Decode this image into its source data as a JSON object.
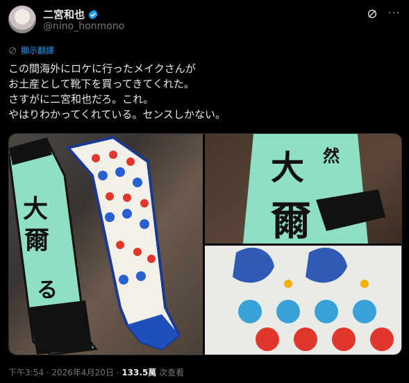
{
  "author": {
    "display_name": "二宮和也",
    "handle": "@nino_honmono"
  },
  "translate_label": "顯示翻譯",
  "tweet_text": "この間海外にロケに行ったメイクさんが\nお土産として靴下を買ってきてくれた。\nさすがに二宮和也だろ。これ。\nやはりわかってくれている。センスしかない。",
  "timestamp": "下午3:54 · 2026年4月20日",
  "views_count": "133.5萬",
  "views_label": "次查看",
  "colors": {
    "background": "#000000",
    "text": "#e7e9ea",
    "muted": "#71767b",
    "accent": "#1d9bf0"
  },
  "icons": [
    "verified-badge-icon",
    "grok-icon",
    "more-icon",
    "globe-icon"
  ]
}
